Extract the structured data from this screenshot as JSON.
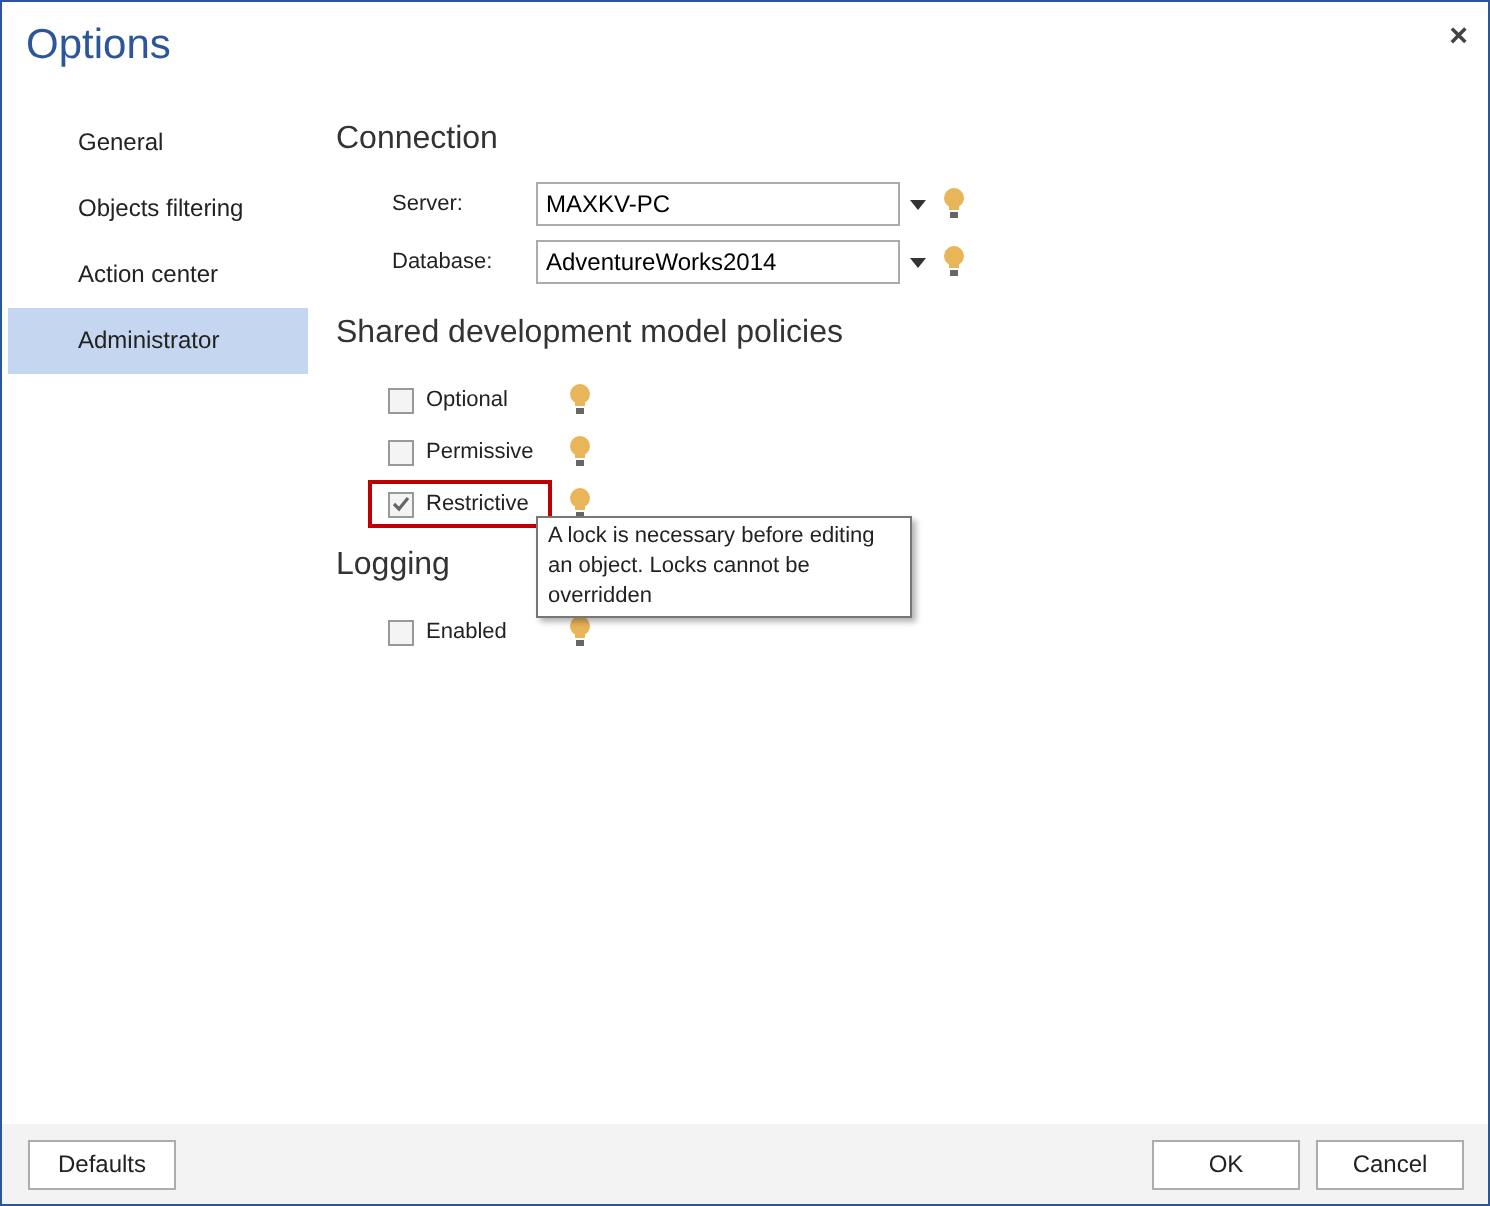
{
  "window": {
    "title": "Options",
    "close": "×"
  },
  "sidebar": {
    "items": [
      {
        "label": "General",
        "selected": false
      },
      {
        "label": "Objects filtering",
        "selected": false
      },
      {
        "label": "Action center",
        "selected": false
      },
      {
        "label": "Administrator",
        "selected": true
      }
    ]
  },
  "connection": {
    "heading": "Connection",
    "fields": [
      {
        "label": "Server:",
        "value": "MAXKV-PC"
      },
      {
        "label": "Database:",
        "value": "AdventureWorks2014"
      }
    ]
  },
  "policies": {
    "heading": "Shared development model policies",
    "options": [
      {
        "label": "Optional",
        "checked": false,
        "highlighted": false
      },
      {
        "label": "Permissive",
        "checked": false,
        "highlighted": false
      },
      {
        "label": "Restrictive",
        "checked": true,
        "highlighted": true,
        "tooltip": "A lock is necessary before editing an object. Locks cannot be overridden"
      }
    ]
  },
  "logging": {
    "heading": "Logging",
    "options": [
      {
        "label": "Enabled",
        "checked": false,
        "highlighted": false
      }
    ]
  },
  "footer": {
    "buttons": [
      "Defaults",
      "OK",
      "Cancel"
    ]
  }
}
